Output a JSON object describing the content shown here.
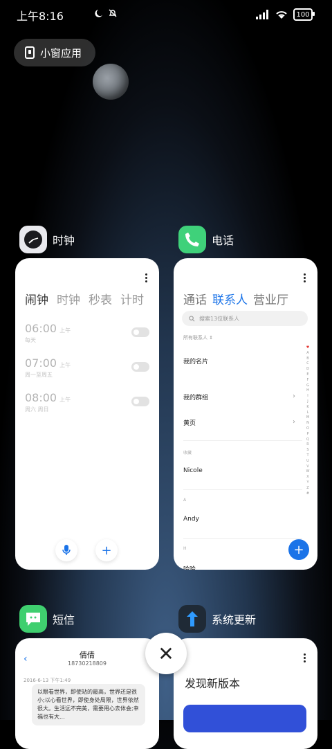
{
  "status_bar": {
    "time": "上午8:16",
    "battery": "100"
  },
  "floating": {
    "label": "小窗应用"
  },
  "cards": {
    "clock": {
      "app_name": "时钟",
      "tabs": [
        "闹钟",
        "时钟",
        "秒表",
        "计时"
      ],
      "alarms": [
        {
          "time": "06:00",
          "ampm": "上午",
          "repeat": "每天"
        },
        {
          "time": "07:00",
          "ampm": "上午",
          "repeat": "周一至周五"
        },
        {
          "time": "08:00",
          "ampm": "上午",
          "repeat": "周六 周日"
        }
      ],
      "mic_icon": "🎙",
      "add_icon": "+"
    },
    "phone": {
      "app_name": "电话",
      "tabs": [
        "通话",
        "联系人",
        "营业厅"
      ],
      "search_placeholder": "搜索13位联系人",
      "all_contacts": "所有联系人",
      "my_card": "我的名片",
      "my_groups": "我的群组",
      "yellow_pages": "黄页",
      "favorites_section": "收藏",
      "favorite_contact": "Nicole",
      "section_a": "A",
      "contact_a": "Andy",
      "section_h": "H",
      "contact_h": "哈哈",
      "index": [
        "♥",
        "A",
        "B",
        "C",
        "D",
        "E",
        "F",
        "G",
        "H",
        "I",
        "J",
        "K",
        "L",
        "M",
        "N",
        "O",
        "P",
        "Q",
        "R",
        "S",
        "T",
        "U",
        "V",
        "W",
        "X",
        "Y",
        "Z",
        "#"
      ]
    },
    "sms": {
      "app_name": "短信",
      "contact_name": "倩倩",
      "contact_number": "18730218809",
      "date": "2016-6-13 下午1:49",
      "message": "以眼看世界，即使站的最高，世界还是很小;以心看世界，即使身处局限，世界依然很大。生活远不完美，需要用心去体会;幸福也有大..."
    },
    "update": {
      "app_name": "系统更新",
      "title": "发现新版本"
    }
  },
  "close_icon": "✕"
}
